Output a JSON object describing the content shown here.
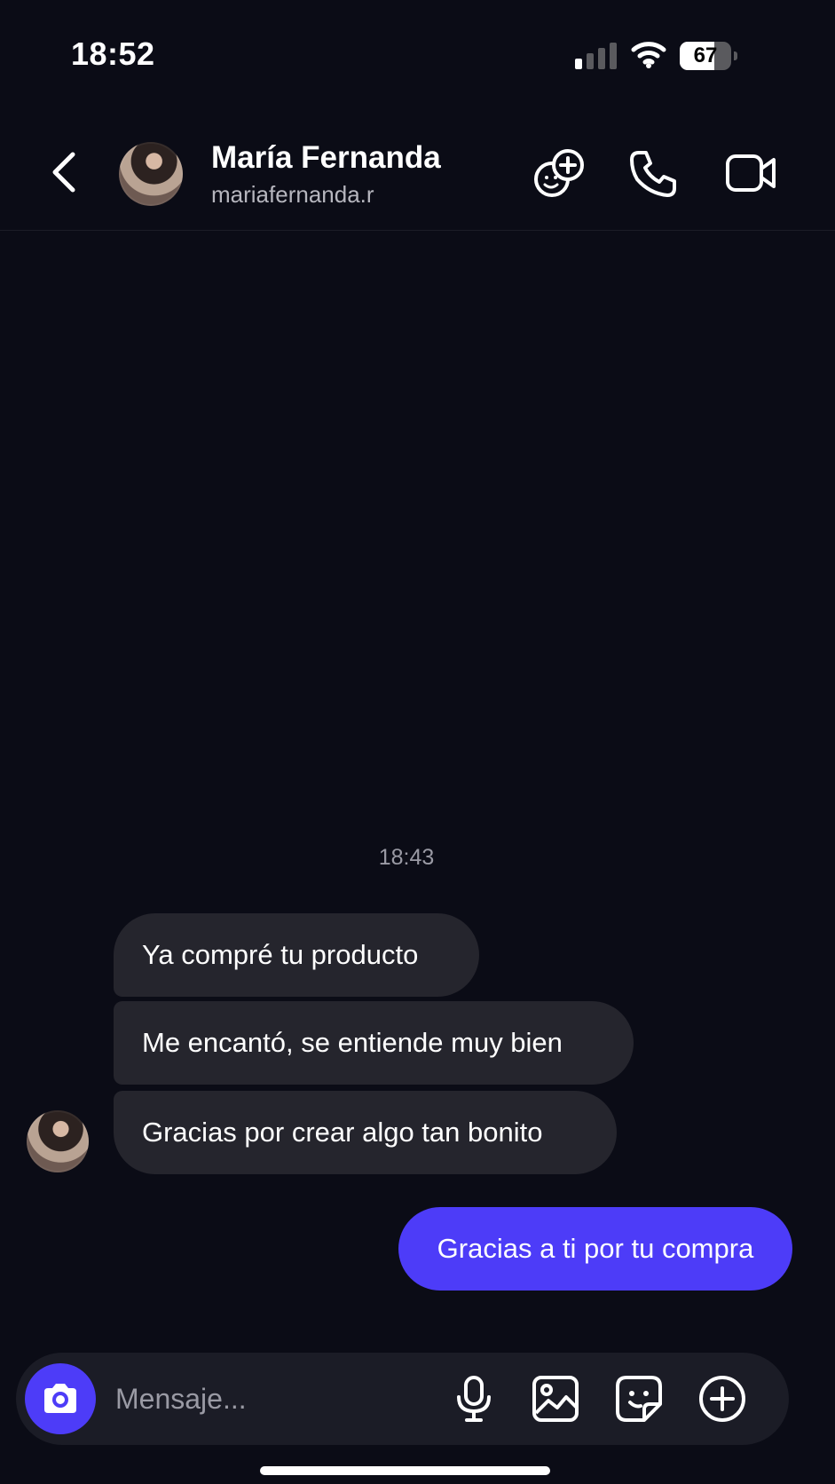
{
  "status_bar": {
    "time": "18:52",
    "battery_percent": 67,
    "battery_label": "67",
    "signal_bars_active": 1,
    "signal_bars_total": 4
  },
  "header": {
    "name": "María Fernanda",
    "username": "mariafernanda.r",
    "icons": [
      "back-chevron-icon",
      "add-people-icon",
      "phone-icon",
      "video-call-icon"
    ]
  },
  "conversation": {
    "timestamp": "18:43",
    "received": [
      {
        "text": "Ya compré tu producto"
      },
      {
        "text": "Me encantó, se entiende muy bien"
      },
      {
        "text": "Gracias por crear algo tan bonito"
      }
    ],
    "sent": [
      {
        "text": "Gracias a ti por tu compra"
      }
    ]
  },
  "composer": {
    "placeholder": "Mensaje...",
    "value": "",
    "icons": [
      "camera-icon",
      "microphone-icon",
      "gallery-icon",
      "sticker-icon",
      "plus-circle-icon"
    ]
  },
  "colors": {
    "background": "#0b0c16",
    "received_bubble": "#25252d",
    "accent": "#4d3cf8",
    "composer_bg": "#1b1c26"
  }
}
